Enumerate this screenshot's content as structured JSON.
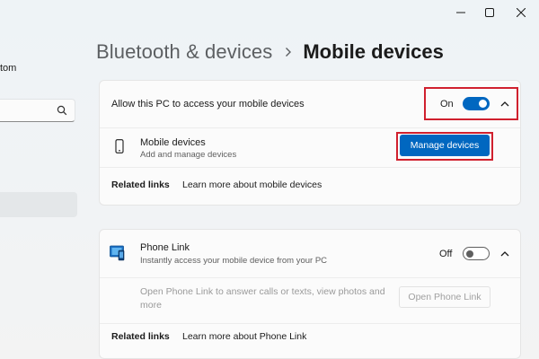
{
  "window": {
    "controls": {
      "minimize_icon": "minimize-icon",
      "maximize_icon": "maximize-icon",
      "close_icon": "close-icon"
    }
  },
  "nav": {
    "account_text": "tom",
    "search_icon": "search-icon"
  },
  "breadcrumb": {
    "parent": "Bluetooth & devices",
    "current": "Mobile devices"
  },
  "mobile_access": {
    "label": "Allow this PC to access your mobile devices",
    "toggle_state": "On",
    "toggle_on": true,
    "expanded": true,
    "device_row": {
      "title": "Mobile devices",
      "subtitle": "Add and manage devices",
      "icon": "phone-icon",
      "button_label": "Manage devices"
    },
    "related": {
      "heading": "Related links",
      "link": "Learn more about mobile devices"
    }
  },
  "phone_link": {
    "title": "Phone Link",
    "subtitle": "Instantly access your mobile device from your PC",
    "icon": "phone-link-icon",
    "toggle_state": "Off",
    "toggle_on": false,
    "expanded": true,
    "open_description": "Open Phone Link to answer calls or texts, view photos and more",
    "open_button_label": "Open Phone Link",
    "related": {
      "heading": "Related links",
      "link": "Learn more about Phone Link"
    }
  },
  "colors": {
    "accent": "#0067c0",
    "highlight": "#d0202e",
    "background": "#eef2f4"
  }
}
